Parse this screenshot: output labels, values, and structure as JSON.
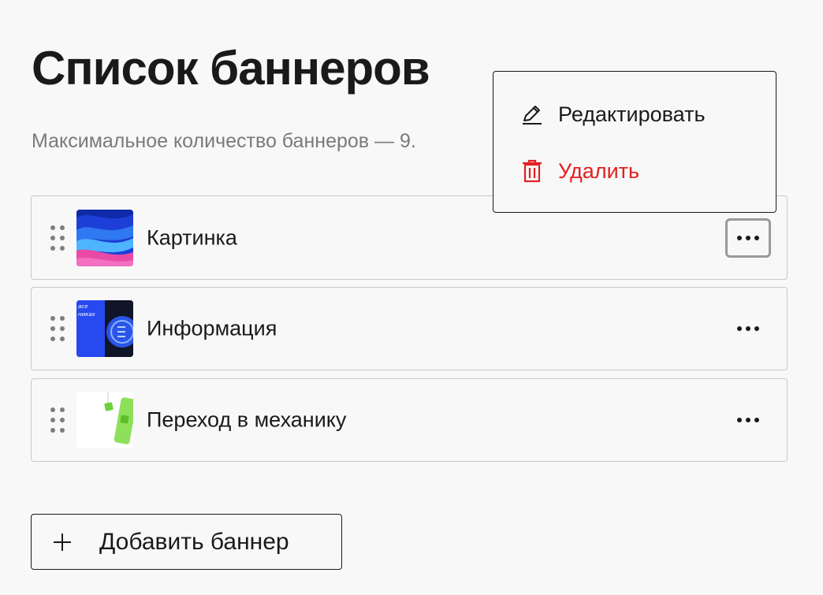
{
  "page": {
    "title": "Список баннеров",
    "subtitle": "Максимальное количество баннеров — 9."
  },
  "banners": [
    {
      "label": "Картинка",
      "thumbnail": "abstract-blue-pink-waves"
    },
    {
      "label": "Информация",
      "thumbnail": "blue-promo-coin",
      "thumb_text_1": "асе",
      "thumb_text_2": "никах"
    },
    {
      "label": "Переход в механику",
      "thumbnail": "green-phone-mechanic"
    }
  ],
  "menu": {
    "edit_label": "Редактировать",
    "edit_icon": "pencil-icon",
    "delete_label": "Удалить",
    "delete_icon": "trash-icon",
    "delete_color": "#e41f1f"
  },
  "add_button": {
    "label": "Добавить баннер",
    "icon": "plus-icon"
  },
  "colors": {
    "text": "#1a1a1a",
    "muted": "#7a7a7a",
    "border": "#c8c8c8",
    "background": "#f8f8f8",
    "danger": "#e41f1f"
  }
}
